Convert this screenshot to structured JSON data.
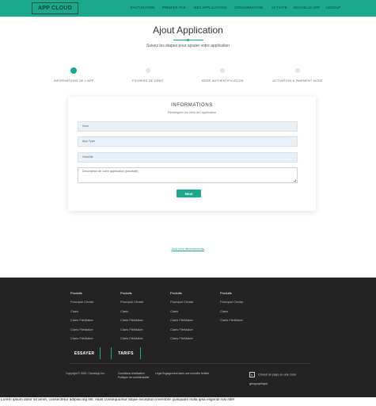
{
  "brand": {
    "logo": "APP CLOUD",
    "accent": "#1aaa8b",
    "footer_bg": "#232323"
  },
  "nav": {
    "items": [
      "FACTURATION",
      "PREMIER PAS",
      "MES APPLICATIONS",
      "CONSOMMATION",
      "ACTIVITÉ",
      "NOUVELLE APP",
      "LOGOUT"
    ]
  },
  "hero": {
    "title": "Ajout Application",
    "subtitle": "Suivez les étapes pour ajouter votre application"
  },
  "steps": {
    "active": 0,
    "items": [
      "INFORMATIONS DE L'APP",
      "FICHIERS DE DÉBIT",
      "MODE AUTHENTIFICATION",
      "ACTIVATION & PAIEMENT MODE"
    ]
  },
  "form": {
    "title": "INFORMATIONS",
    "subtitle": "Renseignez les infos de l'application",
    "fields": [
      {
        "value": "",
        "placeholder": "Nom"
      },
      {
        "value": "",
        "placeholder": "App Type"
      },
      {
        "value": "",
        "placeholder": "Visibilité"
      }
    ],
    "textarea_placeholder": "Description de votre application (facultatif)",
    "next_label": "Next"
  },
  "pricing_link": "Voir mes abonnements",
  "footer": {
    "columns": [
      {
        "heading": "Produits",
        "items": [
          "Pourquoi Choisir",
          "Claris",
          "Claris FileMaker",
          "Claris FileMaker",
          "Claris FileMaker"
        ]
      },
      {
        "heading": "Produits",
        "items": [
          "Pourquoi Choisir",
          "Claris",
          "Claris FileMaker",
          "Claris FileMaker",
          "Claris FileMaker"
        ]
      },
      {
        "heading": "Produits",
        "items": [
          "Pourquoi Choisir",
          "Claris",
          "Claris FileMaker",
          "Claris FileMaker",
          "Claris FileMaker"
        ]
      },
      {
        "heading": "Produits",
        "items": [
          "Pourquoi Choisir",
          "Claris",
          "Claris FileMaker"
        ]
      }
    ],
    "buttons": {
      "try": "ESSAYER",
      "pricing": "TARIFS"
    },
    "copyright": "Copyright © 2020, CloudApp Inc.",
    "legal_links": [
      "Conditions d'utilisation",
      "Politique de confidentialité",
      "Legal Engagement dans une nouvelle fenêtre"
    ],
    "region_label": "Choisir un pays ou une zone",
    "region_label_2": "géographique"
  },
  "lorem": "Lorem ipsum dolor sit amet, consectetur adipisicing elit. Alias consequuntur atque excepturi inventore quisquam nulla ipsa eligendi nisi iste!"
}
